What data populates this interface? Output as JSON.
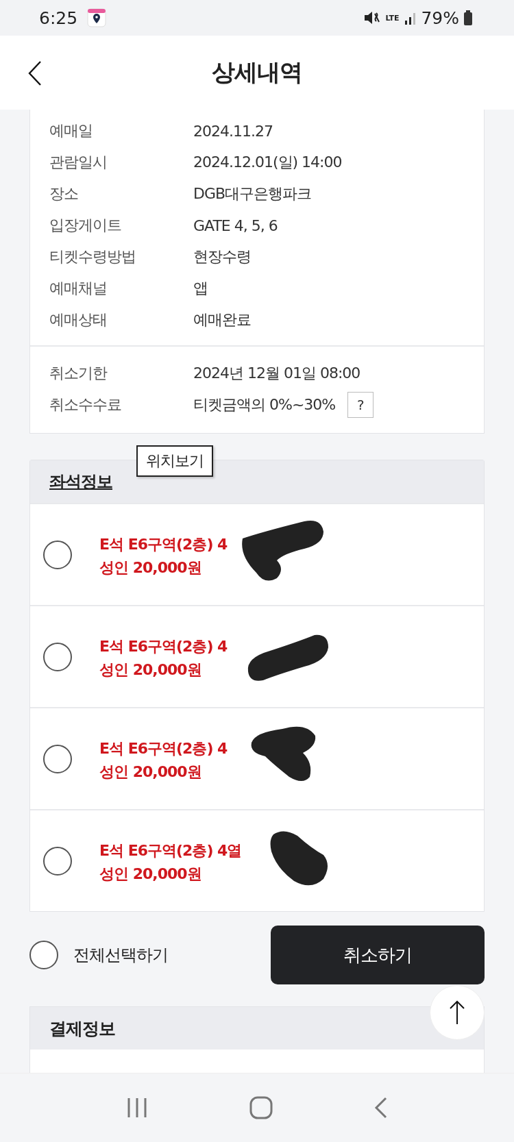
{
  "status_bar": {
    "time": "6:25",
    "battery": "79%",
    "network": "LTE"
  },
  "header": {
    "title": "상세내역"
  },
  "booking_info": [
    {
      "label": "예매일",
      "value": "2024.11.27"
    },
    {
      "label": "관람일시",
      "value": "2024.12.01(일) 14:00"
    },
    {
      "label": "장소",
      "value": "DGB대구은행파크"
    },
    {
      "label": "입장게이트",
      "value": "GATE 4, 5, 6"
    },
    {
      "label": "티켓수령방법",
      "value": "현장수령"
    },
    {
      "label": "예매채널",
      "value": "앱"
    },
    {
      "label": "예매상태",
      "value": "예매완료"
    }
  ],
  "cancel_info": [
    {
      "label": "취소기한",
      "value": "2024년 12월 01일 08:00",
      "help": false
    },
    {
      "label": "취소수수료",
      "value": "티켓금액의 0%~30%",
      "help": true,
      "help_label": "?"
    }
  ],
  "seat_section": {
    "title": "좌석정보",
    "tooltip": "위치보기",
    "seats": [
      {
        "seat": "E석 E6구역(2층) 4",
        "price": "성인 20,000원",
        "selected": false
      },
      {
        "seat": "E석 E6구역(2층) 4",
        "price": "성인 20,000원",
        "selected": false
      },
      {
        "seat": "E석 E6구역(2층) 4",
        "price": "성인 20,000원",
        "selected": false
      },
      {
        "seat": "E석 E6구역(2층) 4열",
        "price": "성인 20,000원",
        "selected": false
      }
    ]
  },
  "select_all": {
    "label": "전체선택하기",
    "selected": false
  },
  "cancel_button": "취소하기",
  "payment_section": {
    "title": "결제정보"
  }
}
